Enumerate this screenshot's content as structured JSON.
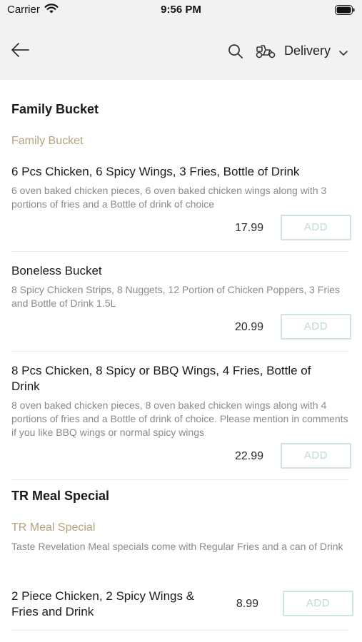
{
  "status_bar": {
    "carrier": "Carrier",
    "time": "9:56 PM"
  },
  "nav": {
    "delivery_label": "Delivery",
    "icons": [
      "back-arrow-icon",
      "search-icon",
      "scooter-icon",
      "chevron-down-icon"
    ]
  },
  "sections": [
    {
      "title": "Family Bucket",
      "subtitle": "Family Bucket",
      "items": [
        {
          "name": "6 Pcs Chicken, 6 Spicy Wings, 3 Fries, Bottle of Drink",
          "description": "6 oven baked chicken pieces, 6 oven baked chicken wings along with 3 portions of fries and a Bottle of drink of choice",
          "price": "17.99",
          "add_label": "ADD"
        },
        {
          "name": "Boneless Bucket",
          "description": "8 Spicy Chicken Strips, 8 Nuggets, 12 Portion of Chicken Poppers, 3 Fries and Bottle of Drink 1.5L",
          "price": "20.99",
          "add_label": "ADD"
        },
        {
          "name": "8 Pcs Chicken, 8 Spicy or BBQ Wings, 4 Fries, Bottle of Drink",
          "description": "8 oven baked chicken pieces, 8 oven baked chicken wings along with 4 portions of fries and a Bottle of drink of choice. Please mention in comments if you like BBQ wings or normal spicy wings",
          "price": "22.99",
          "add_label": "ADD"
        }
      ]
    },
    {
      "title": "TR Meal Special",
      "subtitle": "TR Meal Special",
      "description": "Taste Revelation Meal specials come with Regular Fries and a can of Drink",
      "items": [
        {
          "name": "2 Piece Chicken, 2 Spicy Wings & Fries and Drink",
          "price": "8.99",
          "add_label": "ADD"
        }
      ]
    }
  ],
  "colors": {
    "header_bg": "#f2f2f2",
    "subtitle": "#b3a37c",
    "description": "#8a8a8a",
    "add_button_border": "#cfe6d6",
    "add_button_text": "#bfdcc9"
  }
}
